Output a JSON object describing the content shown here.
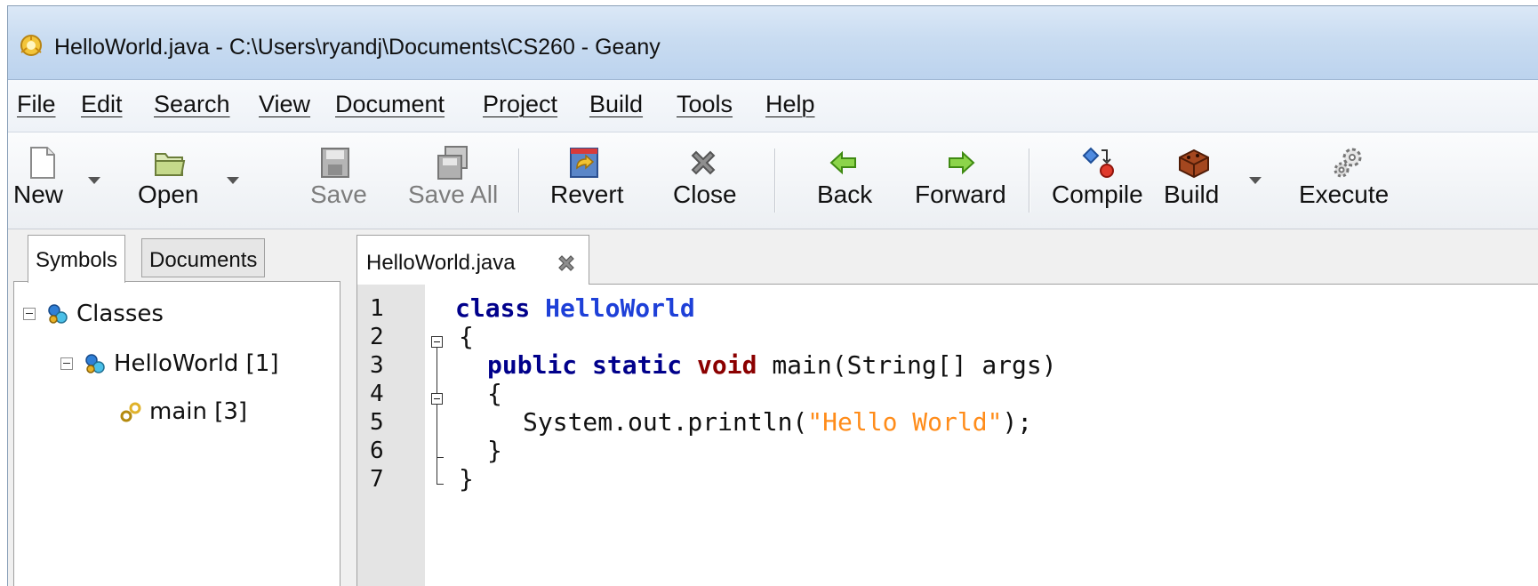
{
  "window": {
    "title": "HelloWorld.java - C:\\Users\\ryandj\\Documents\\CS260 - Geany"
  },
  "menu": [
    "File",
    "Edit",
    "Search",
    "View",
    "Document",
    "Project",
    "Build",
    "Tools",
    "Help"
  ],
  "toolbar": {
    "new": "New",
    "open": "Open",
    "save": "Save",
    "save_all": "Save All",
    "revert": "Revert",
    "close": "Close",
    "back": "Back",
    "forward": "Forward",
    "compile": "Compile",
    "build": "Build",
    "execute": "Execute"
  },
  "sidebar": {
    "tabs": [
      "Symbols",
      "Documents"
    ],
    "tree": [
      {
        "label": "Classes",
        "icon": "classes-icon"
      },
      {
        "label": "HelloWorld [1]",
        "icon": "class-icon"
      },
      {
        "label": "main [3]",
        "icon": "method-icon"
      }
    ]
  },
  "editor": {
    "tab_label": "HelloWorld.java",
    "line_numbers": [
      "1",
      "2",
      "3",
      "4",
      "5",
      "6",
      "7"
    ],
    "code": {
      "l1_kw": "class",
      "l1_name": "HelloWorld",
      "l2": "{",
      "l3_kw1": "public",
      "l3_kw2": "static",
      "l3_kw3": "void",
      "l3_rest": " main(String[] args)",
      "l4": "{",
      "l5_pre": "System.out.println(",
      "l5_str": "\"Hello World\"",
      "l5_post": ");",
      "l6": "}",
      "l7": "}"
    }
  },
  "colors": {
    "keyword": "#00008b",
    "void_keyword": "#8b0000",
    "class_name": "#1e40d8",
    "string": "#ff8c1a"
  }
}
